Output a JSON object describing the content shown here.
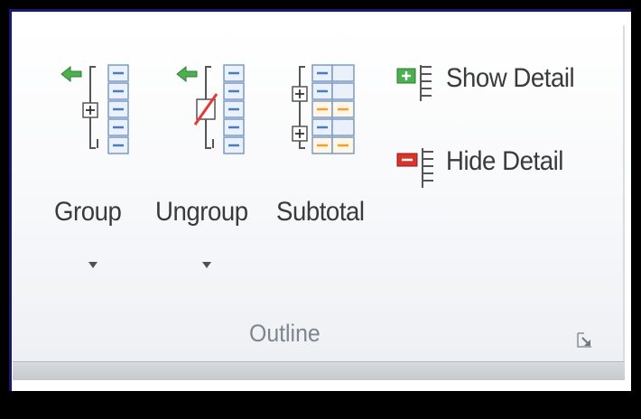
{
  "ribbon_group": {
    "title": "Outline",
    "launcher_icon": "dialog-launcher-icon",
    "buttons": [
      {
        "label": "Group",
        "icon": "group-icon",
        "has_dropdown": true
      },
      {
        "label": "Ungroup",
        "icon": "ungroup-icon",
        "has_dropdown": true
      },
      {
        "label": "Subtotal",
        "icon": "subtotal-icon",
        "has_dropdown": false
      }
    ],
    "small_buttons": [
      {
        "label": "Show Detail",
        "icon": "show-detail-icon"
      },
      {
        "label": "Hide Detail",
        "icon": "hide-detail-icon"
      }
    ]
  },
  "colors": {
    "label_text": "#3a3a3a",
    "title_text": "#7e8590",
    "icon_blue": "#4a7cc0",
    "arrow_green": "#4caf50",
    "minus_red": "#d9342b",
    "subtotal_orange": "#f0a030"
  }
}
